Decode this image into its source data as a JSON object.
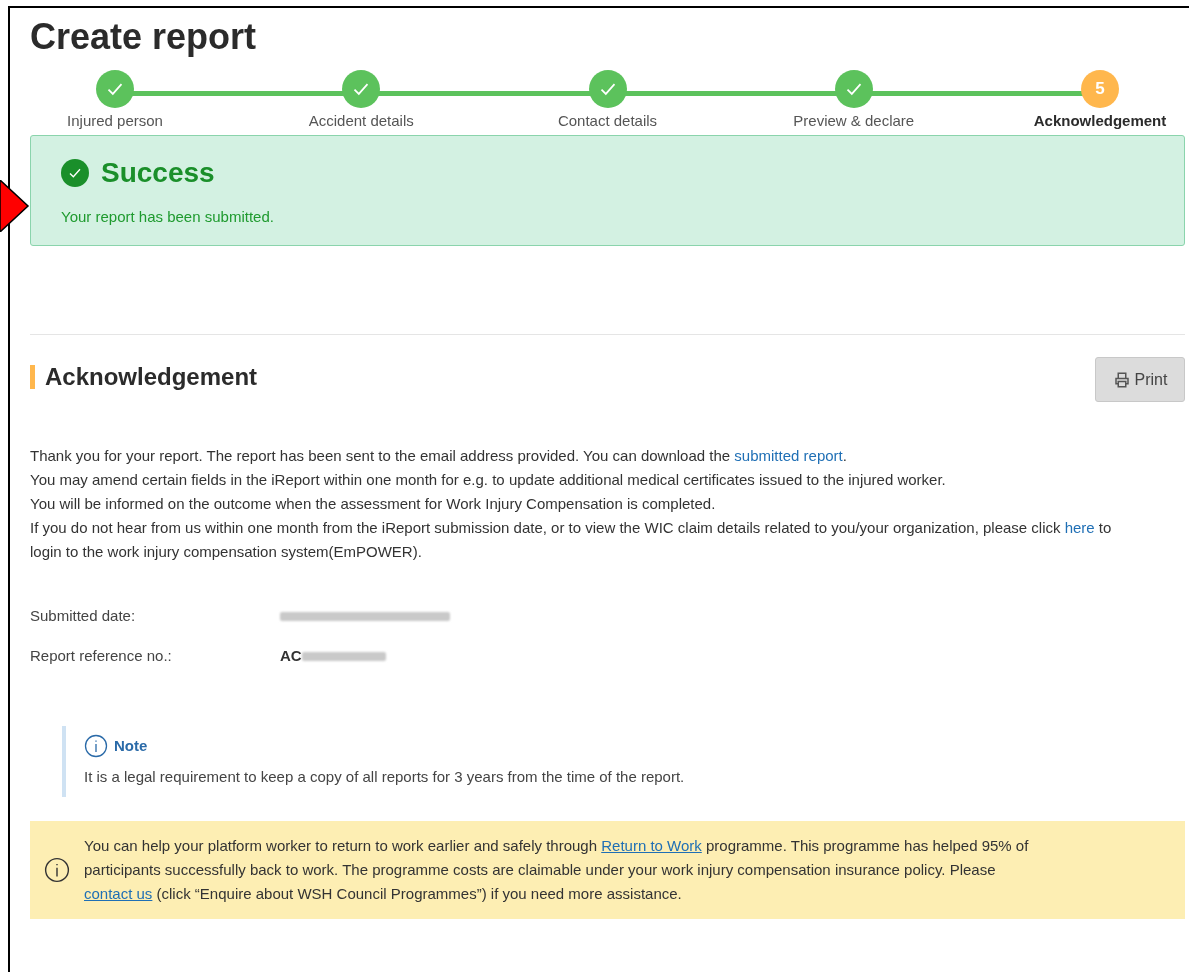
{
  "page": {
    "title": "Create report"
  },
  "steps": [
    {
      "label": "Injured person",
      "kind": "done"
    },
    {
      "label": "Accident details",
      "kind": "done"
    },
    {
      "label": "Contact details",
      "kind": "done"
    },
    {
      "label": "Preview & declare",
      "kind": "done"
    },
    {
      "label": "Acknowledgement",
      "kind": "current",
      "number": "5"
    }
  ],
  "success": {
    "title": "Success",
    "message": "Your report has been submitted."
  },
  "section": {
    "title": "Acknowledgement",
    "print_button": "Print"
  },
  "paragraphs": [
    [
      {
        "text": "Thank you for your report. The report has been sent to the email address provided. You can download the "
      },
      {
        "text": "submitted report",
        "link": true
      },
      {
        "text": "."
      }
    ],
    [
      {
        "text": "You may amend certain fields in the iReport within one month for e.g. to update additional medical certificates issued to the injured worker."
      }
    ],
    [
      {
        "text": "You will be informed on the outcome when the assessment for Work Injury Compensation is completed."
      }
    ],
    [
      {
        "text": "If you do not hear from us within one month from the iReport submission date, or to view the WIC claim details related to you/your organization, please click "
      },
      {
        "text": "here",
        "link": true
      },
      {
        "text": " to login to the work injury compensation system(EmPOWER)."
      }
    ]
  ],
  "fields": [
    {
      "label": "Submitted date:",
      "redacted": true
    },
    {
      "label": "Report reference no.:",
      "value": "AC",
      "redacted": true
    }
  ],
  "note": {
    "title": "Note",
    "text": "It is a legal requirement to keep a copy of all reports for 3 years from the time of the report."
  },
  "banner": [
    {
      "text": "You can help your platform worker to return to work earlier and safely through "
    },
    {
      "text": "Return to Work",
      "link": true
    },
    {
      "text": " programme. This programme has helped 95% of participants successfully back to work. The programme costs are claimable under your work injury compensation insurance policy. Please "
    },
    {
      "text": "contact us",
      "link": true
    },
    {
      "text": " (click “Enquire about WSH Council Programmes”) if you need more assistance."
    }
  ]
}
